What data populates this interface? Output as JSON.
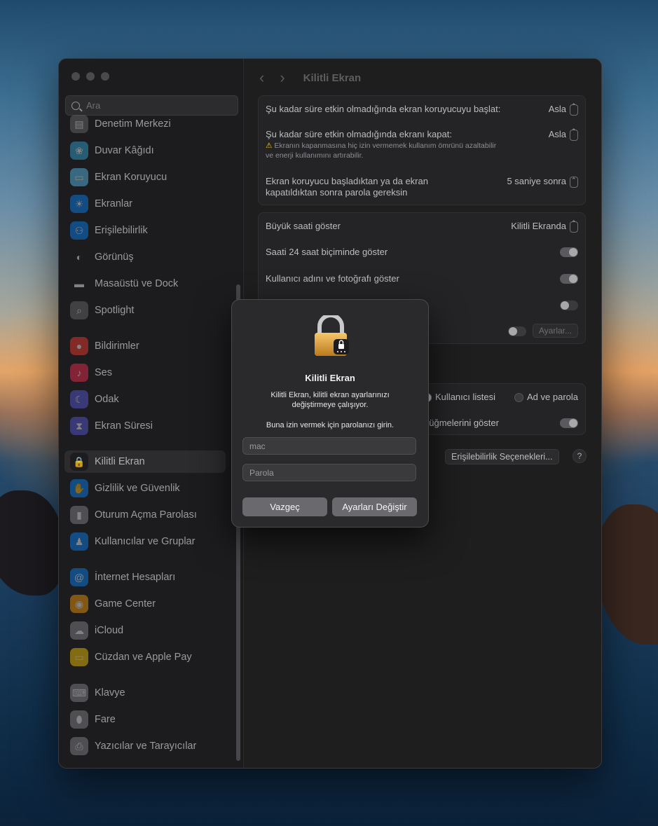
{
  "sidebar": {
    "search_placeholder": "Ara",
    "items": [
      {
        "label": "Denetim Merkezi",
        "icon": "control-center-icon",
        "color": "#6e6e73"
      },
      {
        "label": "Duvar Kâğıdı",
        "icon": "wallpaper-icon",
        "color": "#34aadc"
      },
      {
        "label": "Ekran Koruyucu",
        "icon": "screensaver-icon",
        "color": "#5ac8fa"
      },
      {
        "label": "Ekranlar",
        "icon": "displays-icon",
        "color": "#0a84ff"
      },
      {
        "label": "Erişilebilirlik",
        "icon": "accessibility-icon",
        "color": "#0a84ff"
      },
      {
        "label": "Görünüş",
        "icon": "appearance-icon",
        "color": "#1c1c1e"
      },
      {
        "label": "Masaüstü ve Dock",
        "icon": "dock-icon",
        "color": "#1c1c1e"
      },
      {
        "label": "Spotlight",
        "icon": "spotlight-icon",
        "color": "#6e6e73"
      },
      {
        "label": "Bildirimler",
        "icon": "notifications-icon",
        "color": "#ff3b30"
      },
      {
        "label": "Ses",
        "icon": "sound-icon",
        "color": "#ff2d55"
      },
      {
        "label": "Odak",
        "icon": "focus-icon",
        "color": "#5e5ce6"
      },
      {
        "label": "Ekran Süresi",
        "icon": "screen-time-icon",
        "color": "#5e5ce6"
      },
      {
        "label": "Kilitli Ekran",
        "icon": "lock-screen-icon",
        "color": "#1c1c1e"
      },
      {
        "label": "Gizlilik ve Güvenlik",
        "icon": "privacy-hand-icon",
        "color": "#0a84ff"
      },
      {
        "label": "Oturum Açma Parolası",
        "icon": "login-password-icon",
        "color": "#8e8e93"
      },
      {
        "label": "Kullanıcılar ve Gruplar",
        "icon": "users-groups-icon",
        "color": "#0a84ff"
      },
      {
        "label": "İnternet Hesapları",
        "icon": "internet-accounts-icon",
        "color": "#0a84ff"
      },
      {
        "label": "Game Center",
        "icon": "game-center-icon",
        "color": "#ff9f0a"
      },
      {
        "label": "iCloud",
        "icon": "icloud-icon",
        "color": "#8e8e93"
      },
      {
        "label": "Cüzdan ve Apple Pay",
        "icon": "wallet-icon",
        "color": "#ffcc00"
      },
      {
        "label": "Klavye",
        "icon": "keyboard-icon",
        "color": "#8e8e93"
      },
      {
        "label": "Fare",
        "icon": "mouse-icon",
        "color": "#8e8e93"
      },
      {
        "label": "Yazıcılar ve Tarayıcılar",
        "icon": "printer-icon",
        "color": "#8e8e93"
      }
    ],
    "selected": "Kilitli Ekran"
  },
  "header": {
    "title": "Kilitli Ekran"
  },
  "group1": {
    "row1_label": "Şu kadar süre etkin olmadığında ekran koruyucuyu başlat:",
    "row1_value": "Asla",
    "row2_label": "Şu kadar süre etkin olmadığında ekranı kapat:",
    "row2_value": "Asla",
    "row2_warning_line1": "Ekranın kapanmasına hiç izin vermemek kullanım ömrünü azaltabilir",
    "row2_warning_line2": "ve enerji kullanımını artırabilir.",
    "row3_label_line1": "Ekran koruyucu başladıktan ya da ekran",
    "row3_label_line2": "kapatıldıktan sonra parola gereksin",
    "row3_value": "5 saniye sonra"
  },
  "group2": {
    "row1_label": "Büyük saati göster",
    "row1_value": "Kilitli Ekranda",
    "row2_label": "Saati 24 saat biçiminde göster",
    "row3_label": "Kullanıcı adını ve fotoğrafı göster",
    "settings_button": "Ayarlar..."
  },
  "group3": {
    "radio1": "Kullanıcı listesi",
    "radio2": "Ad ve parola",
    "row2_label_partial": "düğmelerini göster"
  },
  "accessibility_button": "Erişilebilirlik Seçenekleri...",
  "help_button": "?",
  "dialog": {
    "title": "Kilitli Ekran",
    "message_line1": "Kilitli Ekran, kilitli ekran ayarlarınızı",
    "message_line2": "değiştirmeye çalışıyor.",
    "prompt": "Buna izin vermek için parolanızı girin.",
    "username_value": "mac",
    "password_placeholder": "Parola",
    "cancel_label": "Vazgeç",
    "confirm_label": "Ayarları Değiştir"
  }
}
